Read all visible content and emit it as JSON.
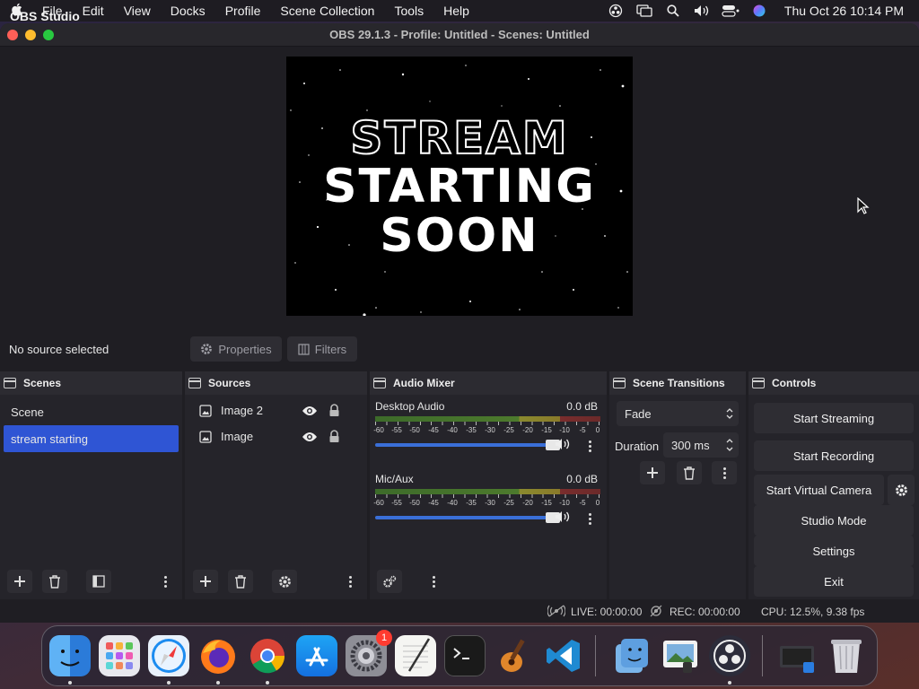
{
  "menubar": {
    "app_name": "OBS Studio",
    "items": [
      "File",
      "Edit",
      "View",
      "Docks",
      "Profile",
      "Scene Collection",
      "Tools",
      "Help"
    ],
    "datetime": "Thu Oct 26  10:14 PM"
  },
  "window": {
    "title": "OBS 29.1.3 - Profile: Untitled - Scenes: Untitled"
  },
  "preview": {
    "line1": "STREAM",
    "line2": "STARTING",
    "line3": "SOON"
  },
  "source_toolbar": {
    "status": "No source selected",
    "properties_label": "Properties",
    "filters_label": "Filters"
  },
  "scenes": {
    "title": "Scenes",
    "items": [
      {
        "label": "Scene",
        "selected": false
      },
      {
        "label": "stream starting",
        "selected": true
      }
    ]
  },
  "sources": {
    "title": "Sources",
    "items": [
      {
        "label": "Image 2"
      },
      {
        "label": "Image"
      }
    ]
  },
  "mixer": {
    "title": "Audio Mixer",
    "scale": [
      "-60",
      "-55",
      "-50",
      "-45",
      "-40",
      "-35",
      "-30",
      "-25",
      "-20",
      "-15",
      "-10",
      "-5",
      "0"
    ],
    "channels": [
      {
        "name": "Desktop Audio",
        "db": "0.0 dB",
        "volume": 1.0
      },
      {
        "name": "Mic/Aux",
        "db": "0.0 dB",
        "volume": 1.0
      }
    ]
  },
  "transitions": {
    "title": "Scene Transitions",
    "selected": "Fade",
    "duration_label": "Duration",
    "duration_value": "300 ms"
  },
  "controls": {
    "title": "Controls",
    "start_streaming": "Start Streaming",
    "start_recording": "Start Recording",
    "start_virtual_camera": "Start Virtual Camera",
    "studio_mode": "Studio Mode",
    "settings": "Settings",
    "exit": "Exit"
  },
  "statusbar": {
    "live": "LIVE: 00:00:00",
    "rec": "REC: 00:00:00",
    "cpu": "CPU: 12.5%, 9.38 fps"
  },
  "dock": {
    "settings_badge": "1",
    "apps": [
      "finder-icon",
      "launchpad-icon",
      "safari-icon",
      "firefox-icon",
      "chrome-icon",
      "app-store-icon",
      "system-settings-icon",
      "textedit-icon",
      "terminal-icon",
      "garageband-icon",
      "vscode-icon",
      "finder-copy-icon",
      "preview-icon",
      "obs-icon",
      "screenshot-icon",
      "trash-icon"
    ]
  },
  "colors": {
    "accent": "#2f55d4",
    "window_bg": "#1f1e23",
    "dock_bg": "#25242a"
  }
}
